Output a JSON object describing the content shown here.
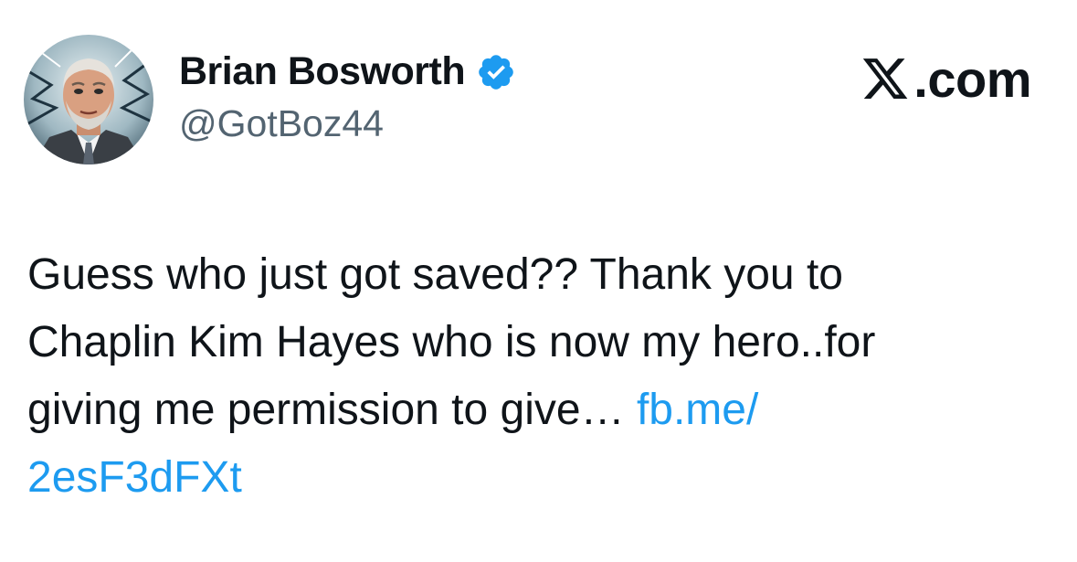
{
  "author": {
    "display_name": "Brian Bosworth",
    "handle": "@GotBoz44",
    "verified": true,
    "verified_icon": "verified-badge-icon",
    "avatar_icon": "avatar-portrait"
  },
  "brand": {
    "mark": "x-logo-icon",
    "text": ".com"
  },
  "tweet": {
    "lines": [
      "Guess who just got saved??  Thank you to",
      "Chaplin Kim Hayes who is now my hero..for",
      "giving me permission to give… "
    ],
    "link_part1": "fb.me/",
    "link_part2": "2esF3dFXt"
  },
  "colors": {
    "text": "#0f1419",
    "secondary": "#536471",
    "link": "#1d9bf0",
    "verified": "#1d9bf0"
  }
}
